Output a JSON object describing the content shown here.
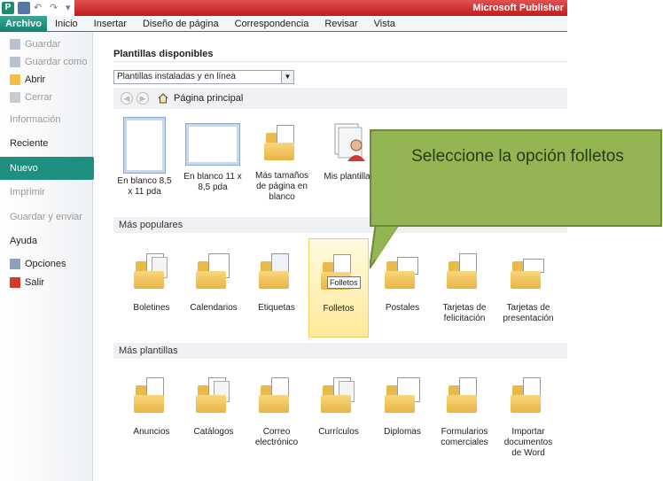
{
  "window": {
    "app_title": "Microsoft Publisher",
    "logo_letter": "P"
  },
  "ribbon": {
    "tabs": [
      {
        "label": "Archivo"
      },
      {
        "label": "Inicio"
      },
      {
        "label": "Insertar"
      },
      {
        "label": "Diseño de página"
      },
      {
        "label": "Correspondencia"
      },
      {
        "label": "Revisar"
      },
      {
        "label": "Vista"
      }
    ]
  },
  "backstage": {
    "guardar": "Guardar",
    "guardar_como": "Guardar como",
    "abrir": "Abrir",
    "cerrar": "Cerrar",
    "informacion": "Información",
    "reciente": "Reciente",
    "nuevo": "Nuevo",
    "imprimir": "Imprimir",
    "guardar_enviar": "Guardar y enviar",
    "ayuda": "Ayuda",
    "opciones": "Opciones",
    "salir": "Salir"
  },
  "main": {
    "title": "Plantillas disponibles",
    "dropdown_value": "Plantillas instaladas y en línea",
    "nav_home": "Página principal",
    "top_tiles": [
      {
        "label": "En blanco 8,5 x 11 pda"
      },
      {
        "label": "En blanco 11 x 8,5 pda"
      },
      {
        "label": "Más tamaños de página en blanco"
      },
      {
        "label": "Mis plantillas"
      }
    ],
    "section_popular": "Más populares",
    "popular_tiles": [
      {
        "label": "Boletines"
      },
      {
        "label": "Calendarios"
      },
      {
        "label": "Etiquetas"
      },
      {
        "label": "Folletos"
      },
      {
        "label": "Postales"
      },
      {
        "label": "Tarjetas de felicitación"
      },
      {
        "label": "Tarjetas de presentación"
      }
    ],
    "tooltip": "Folletos",
    "section_more": "Más plantillas",
    "more_tiles": [
      {
        "label": "Anuncios"
      },
      {
        "label": "Catálogos"
      },
      {
        "label": "Correo electrónico"
      },
      {
        "label": "Currículos"
      },
      {
        "label": "Diplomas"
      },
      {
        "label": "Formularios comerciales"
      },
      {
        "label": "Importar documentos de Word"
      }
    ]
  },
  "callout": {
    "text": "Seleccione la opción folletos",
    "fill": "#93b553",
    "border": "#6a8b30"
  },
  "colors": {
    "accent": "#1f8f7f",
    "title_bar": "#c21a1a"
  }
}
